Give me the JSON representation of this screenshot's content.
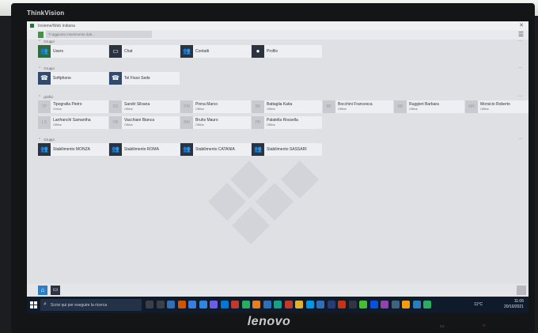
{
  "monitor": {
    "brand_top": "ThinkVision",
    "brand_bottom": "lenovo"
  },
  "window": {
    "title": "Insieme/Web Indiana",
    "close": "✕"
  },
  "search": {
    "placeholder": "Ti aggiunto inserimento dati..."
  },
  "groups": [
    {
      "label": "Gruppi",
      "tiles": [
        {
          "name": "Users",
          "icon": "users-icon"
        },
        {
          "name": "Chat",
          "icon": "chat-icon"
        },
        {
          "name": "Contatti",
          "icon": "contacts-icon"
        },
        {
          "name": "Profilo",
          "icon": "profile-icon"
        }
      ]
    },
    {
      "label": "Gruppi",
      "tiles": [
        {
          "name": "Softphone",
          "icon": "phone-icon"
        },
        {
          "name": "Tel Fisso Sede",
          "icon": "desk-phone-icon"
        }
      ]
    },
    {
      "label": "grafici",
      "tiles": [
        {
          "initials": "TP",
          "name": "Tipografia Pietro",
          "status": "Online"
        },
        {
          "initials": "SS",
          "name": "Sandri Silvana",
          "status": "Offline"
        },
        {
          "initials": "PM",
          "name": "Pinna Marco",
          "status": "Offline"
        },
        {
          "initials": "BK",
          "name": "Battaglia Katia",
          "status": "Offline"
        },
        {
          "initials": "BF",
          "name": "Bocchini Francesca",
          "status": "Offline"
        },
        {
          "initials": "RB",
          "name": "Ruggieri Barbara",
          "status": "Offline"
        },
        {
          "initials": "MR",
          "name": "Morsicio Roberto",
          "status": "Offline"
        },
        {
          "initials": "LS",
          "name": "Lanfranchi Samantha",
          "status": "Offline"
        },
        {
          "initials": "VB",
          "name": "Vacchiani Bianca",
          "status": "Offline"
        },
        {
          "initials": "BM",
          "name": "Bruhs Mauro",
          "status": "Offline"
        },
        {
          "initials": "PR",
          "name": "Palatella Rossella",
          "status": "Offline"
        }
      ]
    },
    {
      "label": "Gruppi",
      "tiles": [
        {
          "name": "Stabilimento MONZA",
          "icon": "group-icon"
        },
        {
          "name": "Stabilimento ROMA",
          "icon": "group-icon"
        },
        {
          "name": "Stabilimento CATANIA",
          "icon": "group-icon"
        },
        {
          "name": "Stabilimento SASSARI",
          "icon": "group-icon"
        }
      ]
    }
  ],
  "group_more": "...",
  "bottom_bar": {
    "home_icon": "home-icon",
    "chat_icon": "chat-icon"
  },
  "taskbar": {
    "search_placeholder": "Scrivi qui per eseguire la ricerca",
    "tray_temp": "11°C",
    "time": "11:06",
    "date": "20/10/2021"
  }
}
